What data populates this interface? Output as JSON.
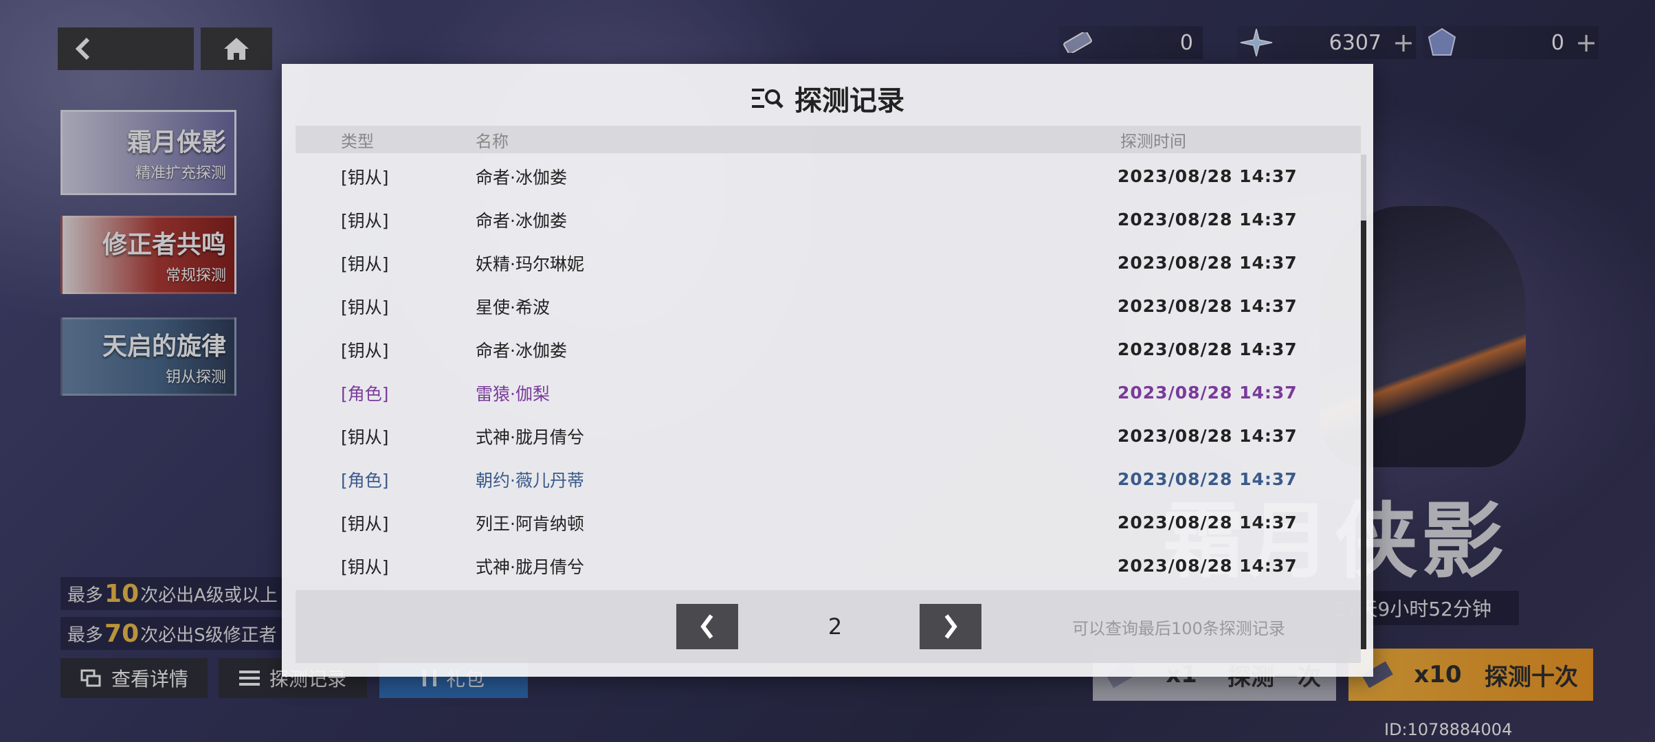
{
  "top_bar": {
    "currencies": [
      {
        "icon": "ticket-icon",
        "value": "0",
        "has_plus": false
      },
      {
        "icon": "crystal-star-icon",
        "value": "6307",
        "has_plus": true
      },
      {
        "icon": "gem-icon",
        "value": "0",
        "has_plus": true
      }
    ],
    "plus_glyph": "+"
  },
  "banners": [
    {
      "title": "霜月侠影",
      "subtitle": "精准扩充探测"
    },
    {
      "title": "修正者共鸣",
      "subtitle": "常规探测"
    },
    {
      "title": "天启的旋律",
      "subtitle": "钥从探测"
    }
  ],
  "left_info": {
    "line1_prefix": "最多",
    "line1_count": "10",
    "line1_suffix": "次必出A级或以上",
    "line2_prefix": "最多",
    "line2_count": "70",
    "line2_suffix": "次必出S级修正者"
  },
  "bottom_buttons": {
    "details": "查看详情",
    "history": "探测记录",
    "gift": "礼包"
  },
  "draw_buttons": {
    "one_count": "x1",
    "one_label": "探测一次",
    "ten_count": "x10",
    "ten_label": "探测十次"
  },
  "background": {
    "big_title": "霜月侠影",
    "timer": "27天9小时52分钟"
  },
  "user_id": "ID:1078884004",
  "modal": {
    "title": "探测记录",
    "headers": {
      "type": "类型",
      "name": "名称",
      "time": "探测时间"
    },
    "rows": [
      {
        "type": "[钥从]",
        "name": "命者·冰伽娄",
        "time": "2023/08/28 14:37",
        "rarity": "normal"
      },
      {
        "type": "[钥从]",
        "name": "命者·冰伽娄",
        "time": "2023/08/28 14:37",
        "rarity": "normal"
      },
      {
        "type": "[钥从]",
        "name": "妖精·玛尔琳妮",
        "time": "2023/08/28 14:37",
        "rarity": "normal"
      },
      {
        "type": "[钥从]",
        "name": "星使·希波",
        "time": "2023/08/28 14:37",
        "rarity": "normal"
      },
      {
        "type": "[钥从]",
        "name": "命者·冰伽娄",
        "time": "2023/08/28 14:37",
        "rarity": "normal"
      },
      {
        "type": "[角色]",
        "name": "雷猿·伽梨",
        "time": "2023/08/28 14:37",
        "rarity": "purple"
      },
      {
        "type": "[钥从]",
        "name": "式神·胧月倩兮",
        "time": "2023/08/28 14:37",
        "rarity": "normal"
      },
      {
        "type": "[角色]",
        "name": "朝约·薇儿丹蒂",
        "time": "2023/08/28 14:37",
        "rarity": "blue"
      },
      {
        "type": "[钥从]",
        "name": "列王·阿肯纳顿",
        "time": "2023/08/28 14:37",
        "rarity": "normal"
      },
      {
        "type": "[钥从]",
        "name": "式神·胧月倩兮",
        "time": "2023/08/28 14:37",
        "rarity": "normal"
      }
    ],
    "pagination": {
      "page": "2",
      "note": "可以查询最后100条探测记录"
    }
  },
  "colors": {
    "normal": "#222222",
    "purple": "#7a3a9a",
    "blue": "#3a5a8a",
    "accent_orange": "#f4a22a"
  }
}
